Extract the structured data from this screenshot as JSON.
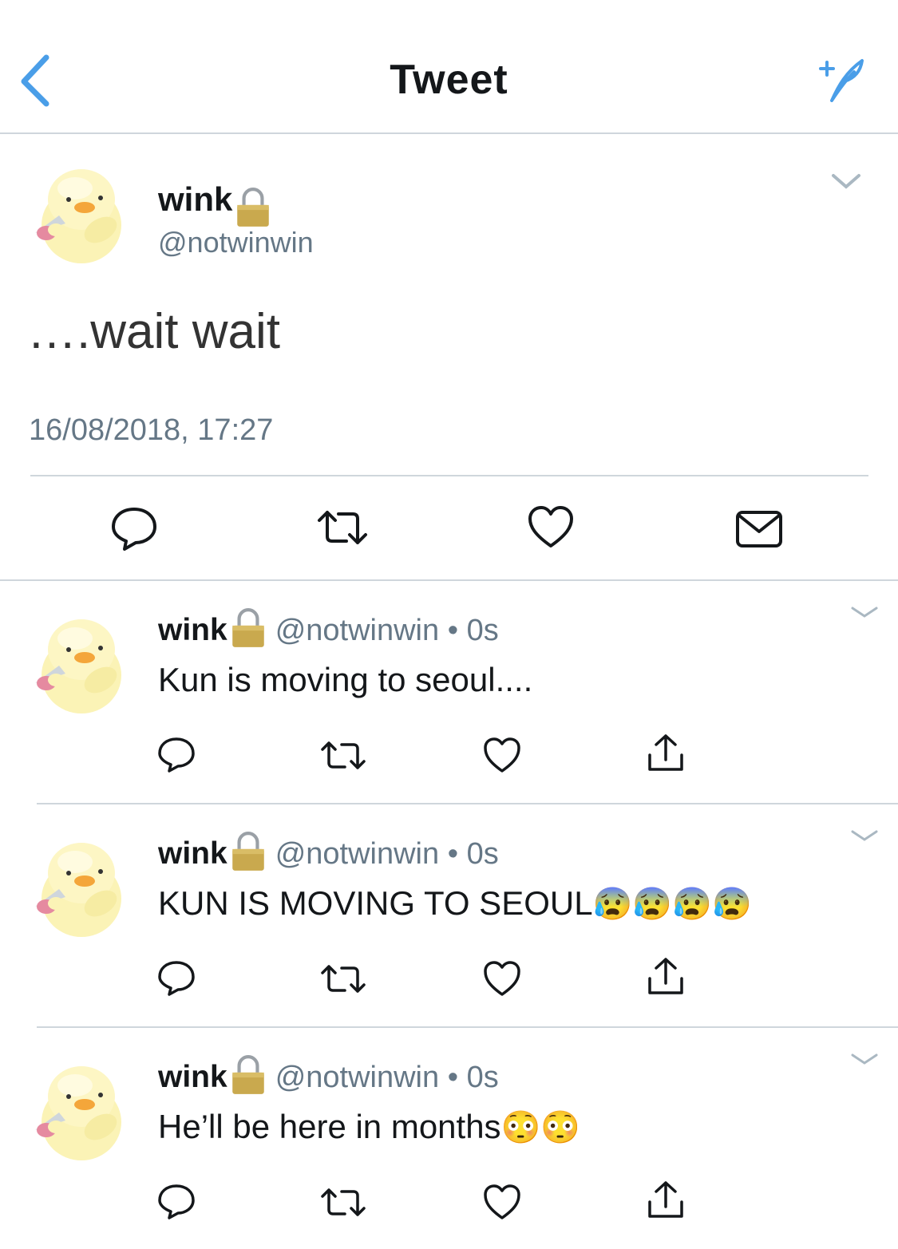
{
  "header": {
    "title": "Tweet",
    "back_icon": "chevron-left-icon",
    "compose_icon": "compose-sparkle-icon",
    "accent": "#4a9ee8"
  },
  "main_tweet": {
    "name": "wink",
    "handle": "@notwinwin",
    "text": "….wait wait",
    "timestamp": "16/08/2018, 17:27",
    "actions": [
      "reply-icon",
      "retweet-icon",
      "like-icon",
      "message-icon"
    ]
  },
  "replies": [
    {
      "name": "wink",
      "handle": "@notwinwin",
      "time": "0s",
      "text": "Kun is moving to seoul....",
      "emojis": []
    },
    {
      "name": "wink",
      "handle": "@notwinwin",
      "time": "0s",
      "text": "KUN IS MOVING TO SEOUL",
      "emojis": [
        "😰",
        "😰",
        "😰",
        "😰"
      ]
    },
    {
      "name": "wink",
      "handle": "@notwinwin",
      "time": "0s",
      "text": "He’ll be here in months",
      "emojis": [
        "😳",
        "😳"
      ]
    }
  ],
  "separator": "•"
}
